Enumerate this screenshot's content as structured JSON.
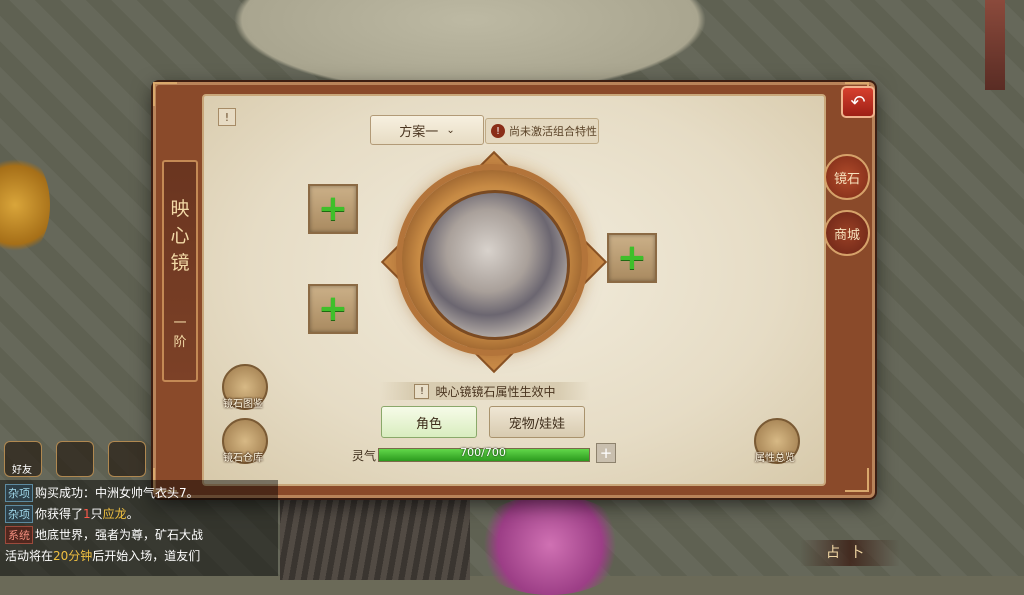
{
  "panel": {
    "title_chars": [
      "映",
      "心",
      "镜"
    ],
    "rank_chars": [
      "一",
      "阶"
    ],
    "info_icon": "!",
    "back_icon": "↶"
  },
  "tabs": [
    {
      "label": "镜石",
      "active": true
    },
    {
      "label": "商城",
      "active": false
    }
  ],
  "scheme": {
    "selected": "方案一",
    "chevron": "⌄"
  },
  "combo_notice": {
    "icon": "!",
    "text": "尚未激活组合特性"
  },
  "slots": [
    {
      "id": "top-left",
      "icon": "+"
    },
    {
      "id": "bottom-left",
      "icon": "+"
    },
    {
      "id": "right",
      "icon": "+"
    }
  ],
  "effect_notice": {
    "icon": "!",
    "text": "映心镜镜石属性生效中"
  },
  "target_tabs": [
    {
      "label": "角色",
      "active": true
    },
    {
      "label": "宠物/娃娃",
      "active": false
    }
  ],
  "spirit": {
    "label": "灵气",
    "current": 700,
    "max": 700,
    "value_text": "700/700",
    "plus": "+"
  },
  "side_buttons": {
    "atlas": "镜石图鉴",
    "storage": "镜石仓库",
    "overview": "属性总览"
  },
  "social": {
    "friends": "好友",
    "chat_icon": "speech-bubble-icon",
    "mic_icon": "microphone-icon"
  },
  "chat": {
    "lines": [
      {
        "tag": "杂项",
        "tag_type": "misc",
        "parts": [
          {
            "t": "购买成功：中洲女帅气衣头7。",
            "c": ""
          }
        ]
      },
      {
        "tag": "杂项",
        "tag_type": "misc",
        "parts": [
          {
            "t": "你获得了",
            "c": ""
          },
          {
            "t": "1",
            "c": "red"
          },
          {
            "t": "只",
            "c": ""
          },
          {
            "t": "应龙",
            "c": "gold"
          },
          {
            "t": "。",
            "c": ""
          }
        ]
      },
      {
        "tag": "系统",
        "tag_type": "sys",
        "parts": [
          {
            "t": "地底世界，强者为尊，矿石大战",
            "c": ""
          }
        ]
      },
      {
        "tag": "",
        "tag_type": "",
        "parts": [
          {
            "t": "活动将在",
            "c": ""
          },
          {
            "t": "20分钟",
            "c": "gold"
          },
          {
            "t": "后开始入场，道友们",
            "c": ""
          }
        ]
      }
    ]
  },
  "fortune": "占卜",
  "colors": {
    "panel_frame": "#8a4a2a",
    "parchment": "#e6dcc5",
    "accent_red": "#b04b2b",
    "spirit_green": "#3fbf2a"
  }
}
